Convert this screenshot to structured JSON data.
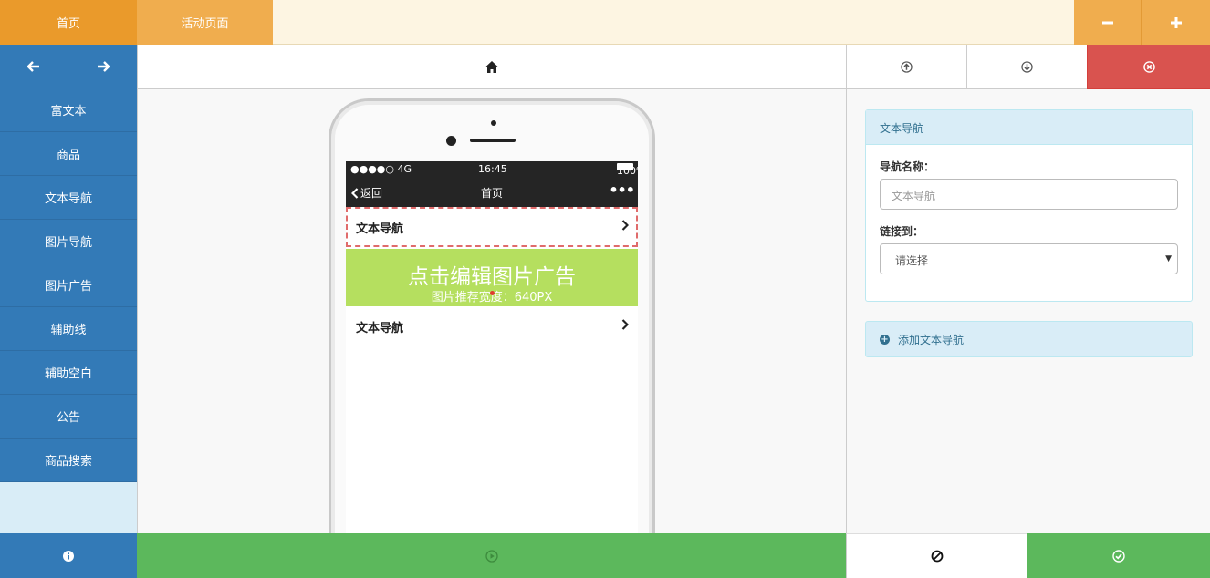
{
  "topbar": {
    "tabs": [
      {
        "label": "首页"
      },
      {
        "label": "活动页面"
      }
    ],
    "zoom_out_label": "−",
    "zoom_in_label": "+"
  },
  "sidebar": {
    "back_icon": "arrow-left-icon",
    "forward_icon": "arrow-right-icon",
    "items": [
      {
        "label": "富文本"
      },
      {
        "label": "商品"
      },
      {
        "label": "文本导航"
      },
      {
        "label": "图片导航"
      },
      {
        "label": "图片广告"
      },
      {
        "label": "辅助线"
      },
      {
        "label": "辅助空白"
      },
      {
        "label": "公告"
      },
      {
        "label": "商品搜索"
      }
    ],
    "info_icon": "info-icon"
  },
  "phone": {
    "status": {
      "signal": "●●●●○ 4G",
      "time": "16:45",
      "battery": "100%"
    },
    "nav": {
      "back": "返回",
      "title": "首页",
      "more": "•••"
    },
    "text_nav_1": "文本导航",
    "ad": {
      "title": "点击编辑图片广告",
      "subtitle": "图片推荐宽度：640PX"
    },
    "text_nav_2": "文本导航"
  },
  "toolbar": {
    "up_icon": "arrow-circle-up-icon",
    "down_icon": "arrow-circle-down-icon",
    "delete_icon": "close-circle-icon"
  },
  "panel": {
    "title": "文本导航",
    "name_label": "导航名称：",
    "name_placeholder": "文本导航",
    "link_label": "链接到：",
    "link_selected": "请选择",
    "add_label": "添加文本导航"
  },
  "footer": {
    "preview_icon": "play-circle-icon",
    "cancel_icon": "ban-icon",
    "confirm_icon": "check-circle-icon"
  },
  "colors": {
    "orange": "#ea9a2b",
    "orange_light": "#f0ad4e",
    "blue": "#337ab7",
    "green": "#5cb85c",
    "red": "#d9534f",
    "ad_green": "#b5df5f"
  }
}
